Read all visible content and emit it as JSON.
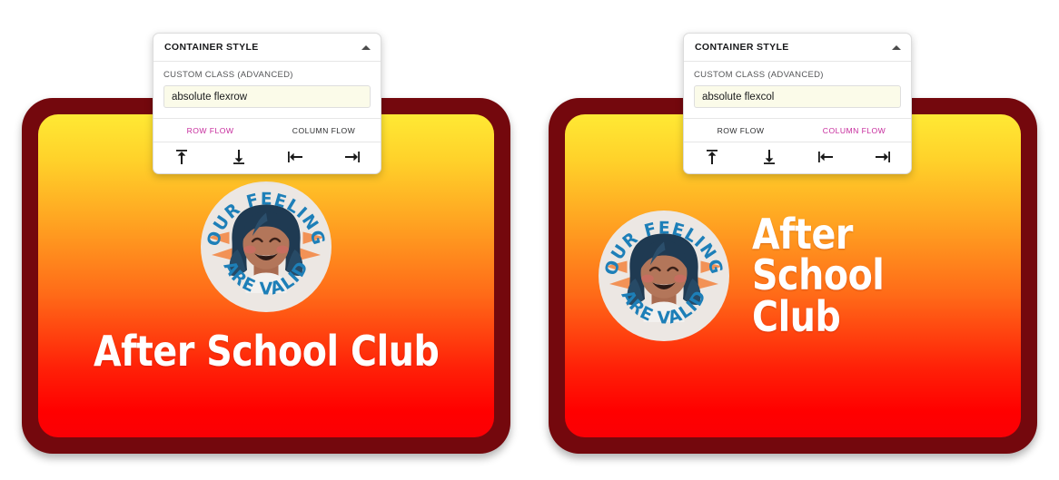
{
  "panels": [
    {
      "id": "left",
      "header": {
        "title": "CONTAINER STYLE",
        "collapse_icon": "chevron-up-icon"
      },
      "field": {
        "label": "CUSTOM CLASS (ADVANCED)",
        "value": "absolute flexrow",
        "placeholder": "absolute flexrow"
      },
      "tabs": [
        {
          "label": "ROW FLOW",
          "active": true
        },
        {
          "label": "COLUMN FLOW",
          "active": false
        }
      ],
      "align_buttons": [
        {
          "icon": "align-top-icon"
        },
        {
          "icon": "align-bottom-icon"
        },
        {
          "icon": "align-left-icon"
        },
        {
          "icon": "align-right-icon"
        }
      ]
    },
    {
      "id": "right",
      "header": {
        "title": "CONTAINER STYLE",
        "collapse_icon": "chevron-up-icon"
      },
      "field": {
        "label": "CUSTOM CLASS (ADVANCED)",
        "value": "absolute flexcol",
        "placeholder": "absolute flexcol"
      },
      "tabs": [
        {
          "label": "ROW FLOW",
          "active": false
        },
        {
          "label": "COLUMN FLOW",
          "active": true
        }
      ],
      "align_buttons": [
        {
          "icon": "align-top-icon"
        },
        {
          "icon": "align-bottom-icon"
        },
        {
          "icon": "align-left-icon"
        },
        {
          "icon": "align-right-icon"
        }
      ]
    }
  ],
  "cards": [
    {
      "id": "left-card",
      "layout": "stacked",
      "title": "After School Club",
      "badge": {
        "top_text": "YOUR FEELINGS",
        "bottom_text": "ARE VALID",
        "alt": "your-feelings-are-valid-badge"
      }
    },
    {
      "id": "right-card",
      "layout": "side-by-side",
      "title": "After School Club",
      "badge": {
        "top_text": "YOUR FEELINGS",
        "bottom_text": "ARE VALID",
        "alt": "your-feelings-are-valid-badge"
      }
    }
  ],
  "colors": {
    "card_border": "#74080d",
    "gradient_top": "#ffe934",
    "gradient_mid": "#ff6a18",
    "gradient_bottom": "#ff0000",
    "accent_active_tab": "#c62a9c",
    "input_background": "#fbfbe9",
    "badge_background": "#ece7e3",
    "badge_text": "#1d7fb8",
    "badge_hair": "#1f3a52",
    "badge_skin": "#b3765a",
    "badge_spark": "#f29256",
    "title_text": "#ffffff"
  }
}
